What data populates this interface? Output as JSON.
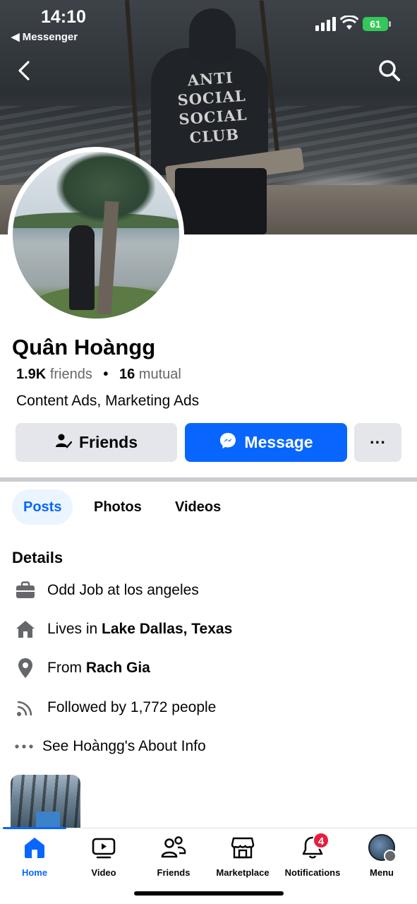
{
  "status_bar": {
    "time": "14:10",
    "back_app": "◀ Messenger",
    "battery": "61"
  },
  "cover": {
    "hoodie_text": "ANTI SOCIAL SOCIAL CLUB"
  },
  "profile": {
    "name": "Quân Hoàngg",
    "friends_count": "1.9K",
    "friends_label": "friends",
    "separator": "•",
    "mutual_count": "16",
    "mutual_label": "mutual",
    "bio": "Content Ads, Marketing Ads"
  },
  "actions": {
    "friends_label": "Friends",
    "message_label": "Message",
    "more_label": "···"
  },
  "tabs": [
    {
      "label": "Posts",
      "active": true
    },
    {
      "label": "Photos",
      "active": false
    },
    {
      "label": "Videos",
      "active": false
    }
  ],
  "details": {
    "title": "Details",
    "work": "Odd Job at los angeles",
    "lives_prefix": "Lives in ",
    "lives_place": "Lake Dallas, Texas",
    "from_prefix": "From ",
    "from_place": "Rach Gia",
    "followed": "Followed by 1,772 people",
    "about": "See Hoàngg's About Info"
  },
  "bottom_nav": {
    "items": [
      {
        "label": "Home",
        "icon": "home-icon",
        "active": true
      },
      {
        "label": "Video",
        "icon": "video-icon",
        "active": false
      },
      {
        "label": "Friends",
        "icon": "friends-icon",
        "active": false
      },
      {
        "label": "Marketplace",
        "icon": "marketplace-icon",
        "active": false
      },
      {
        "label": "Notifications",
        "icon": "bell-icon",
        "active": false
      },
      {
        "label": "Menu",
        "icon": "avatar",
        "active": false
      }
    ],
    "notifications_badge": "4"
  },
  "colors": {
    "accent": "#0866ff",
    "badge": "#e41e3f",
    "button_gray": "#e4e6eb",
    "battery": "#34c759"
  }
}
